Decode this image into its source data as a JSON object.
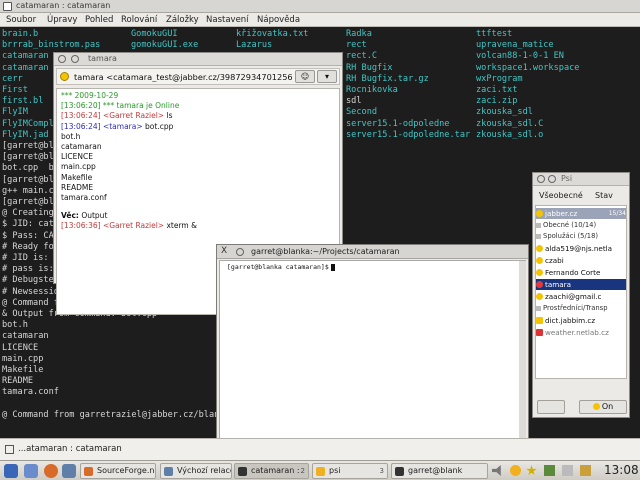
{
  "background_terminal": {
    "title": "catamaran : catamaran",
    "menu": [
      "Soubor",
      "Úpravy",
      "Pohled",
      "Rolování",
      "Záložky",
      "Nastavení",
      "Nápověda"
    ],
    "ls_columns": [
      [
        "brain.b",
        "brrrab_binstrom.pas",
        "catamaran",
        "catamaran",
        "cerr",
        "First",
        "first.bl",
        "FlyIM",
        "FlyIMComple",
        "FlyIM.jad"
      ],
      [
        "GomokuGUI",
        "gomokuGUI.exe"
      ],
      [
        "křižovatka.txt",
        "Lazarus"
      ],
      [
        "Radka",
        "rect",
        "rect.C",
        "RH Bugfix",
        "RH Bugfix.tar.gz",
        "Rocnikovka",
        "sdl",
        "Second",
        "server15.1-odpoledne",
        "server15.1-odpoledne.tar"
      ],
      [
        "ttftest",
        "upravena_matice",
        "volcan88-1-0-1 EN",
        "workspace1.workspace",
        "wxProgram",
        "zaci.txt",
        "zaci.zip",
        "zkouska_sdl",
        "zkouska_sdl.C",
        "zkouska_sdl.o"
      ]
    ],
    "output_lines": [
      "[garret@bla",
      "[garret@bla",
      "bot.cpp  bo",
      "[garret@bla",
      "g++ main.cp",
      "[garret@bla",
      "@ Creating",
      "$ JID: cat",
      "$ Pass: CA",
      "# Ready fo",
      "# JID is: c",
      "# pass is:",
      "# Debugste",
      "# Newsession from: garretraziel@jabber.cz/b",
      "@ Command from garretraziel@jabber.cz/blank",
      "& Output from command: bot.cpp",
      "bot.h",
      "catamaran",
      "LICENCE",
      "main.cpp",
      "Makefile",
      "README",
      "tamara.conf",
      "",
      "@ Command from garretraziel@jabber.cz/blank"
    ]
  },
  "chat_window": {
    "title": "tamara",
    "address": "tamara <catamara_test@jabber.cz/39872934701256",
    "messages": {
      "date": "*** 2009-10-29",
      "online": "[13:06:20] *** tamara je Online",
      "m1_time": "[13:06:24]",
      "m1_nick": "<Garret Raziel>",
      "m1_text": "ls",
      "m2_time": "[13:06:24]",
      "m2_nick": "<tamara>",
      "m2_text": "bot.cpp",
      "lines": [
        "bot.h",
        "catamaran",
        "LICENCE",
        "main.cpp",
        "Makefile",
        "README",
        "tamara.conf"
      ],
      "subject_label": "Věc:",
      "subject": "Output",
      "m3_time": "[13:06:36]",
      "m3_nick": "<Garret Raziel>",
      "m3_text": "xterm &"
    }
  },
  "xterm_window": {
    "close": "X",
    "title": "garret@blanka:~/Projects/catamaran",
    "prompt": "[garret@blanka catamaran]$"
  },
  "psi_window": {
    "title": "Psi",
    "menu": [
      "Všeobecné",
      "Stav"
    ],
    "roster": {
      "account": "jabber.cz",
      "account_count": "15/34",
      "group1": "Obecné (10/14)",
      "group2": "Spolužáci (5/18)",
      "contacts": [
        "alda519@njs.netla",
        "czabi",
        "Fernando Corte",
        "tamara",
        "zaachi@gmail.c",
        "Prostředníci/Transp",
        "dict.jabbim.cz",
        "weather.netlab.cz"
      ]
    },
    "status_button": "On"
  },
  "minimized_bar": {
    "label": "...atamaran : catamaran"
  },
  "taskbar": {
    "tasks": [
      {
        "label": "SourceForge.n",
        "num": ""
      },
      {
        "label": "Výchozí relace",
        "num": ""
      },
      {
        "label": "catamaran :",
        "num": "2"
      },
      {
        "label": "psi",
        "num": "3"
      },
      {
        "label": "garret@blank",
        "num": ""
      }
    ],
    "clock": "13:08"
  },
  "colors": {
    "terminal_bg": "#1d1d1d",
    "terminal_cyan": "#41c6c6",
    "selection": "#1a3580",
    "chat_timestamp_green": "#2a9a2a",
    "chat_nick_red": "#c23b3b"
  }
}
